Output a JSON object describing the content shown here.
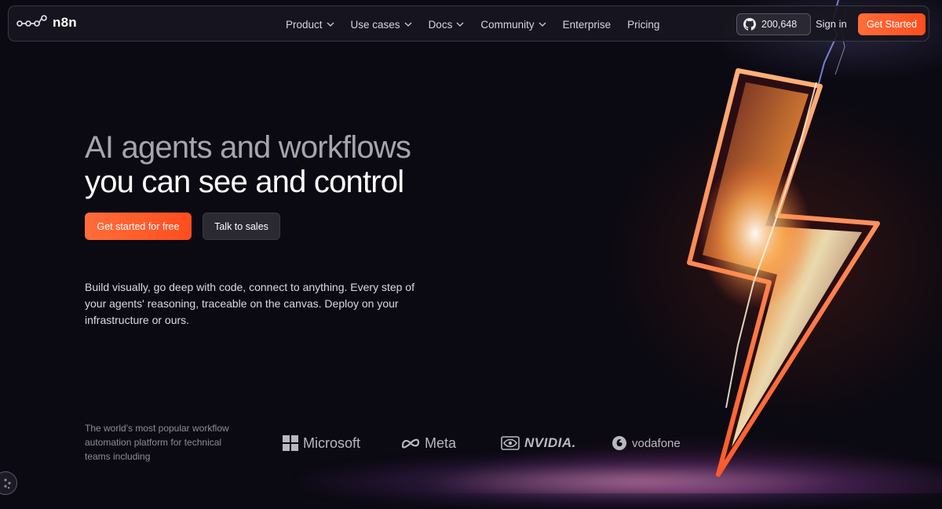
{
  "nav": {
    "logo_text": "n8n",
    "items": [
      {
        "label": "Product",
        "dropdown": true
      },
      {
        "label": "Use cases",
        "dropdown": true
      },
      {
        "label": "Docs",
        "dropdown": true
      },
      {
        "label": "Community",
        "dropdown": true
      },
      {
        "label": "Enterprise",
        "dropdown": false
      },
      {
        "label": "Pricing",
        "dropdown": false
      }
    ],
    "github_stars": "200,648",
    "signin_label": "Sign in",
    "cta_label": "Get Started"
  },
  "hero": {
    "title_line1": "AI agents and workflows",
    "title_line2": "you can see and control",
    "primary_button": "Get started for free",
    "secondary_button": "Talk to sales",
    "description": "Build visually, go deep with code, connect to anything. Every step of your agents' reasoning, traceable on the canvas. Deploy on your infrastructure or ours."
  },
  "trust": {
    "text": "The world's most popular workflow automation platform for technical teams including",
    "brands": [
      "Microsoft",
      "Meta",
      "NVIDIA.",
      "vodafone"
    ]
  },
  "colors": {
    "accent": "#ff5a2a",
    "background": "#0b0912"
  },
  "icons": {
    "logo": "n8n-logo-icon",
    "github": "github-icon",
    "cookie": "cookie-icon"
  }
}
